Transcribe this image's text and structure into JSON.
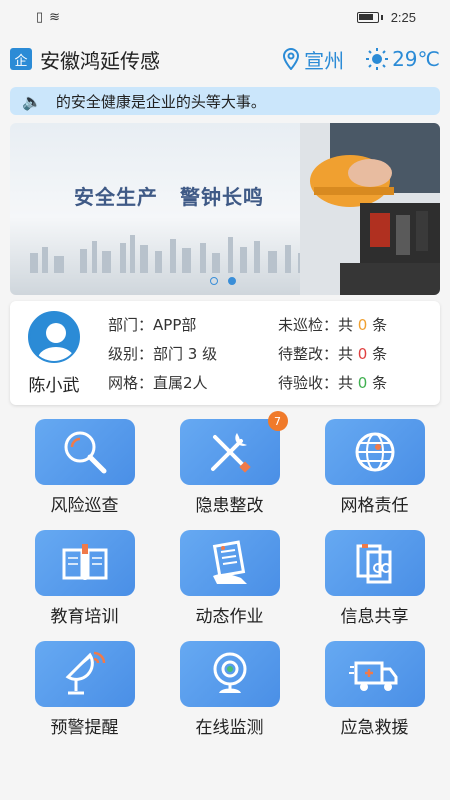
{
  "status_bar": {
    "time": "2:25"
  },
  "header": {
    "logo_char": "企",
    "title": "安徽鸿延传感",
    "location": "宣州",
    "temperature": "29℃"
  },
  "notice": {
    "text": "的安全健康是企业的头等大事。"
  },
  "banner": {
    "slogan_1": "安全生产",
    "slogan_2": "警钟长鸣",
    "page_count": 2,
    "active_page": 2
  },
  "profile": {
    "name": "陈小武",
    "dept_label": "部门：",
    "dept_value": "APP部",
    "level_label": "级别：",
    "level_value": "部门 3 级",
    "grid_label": "网格：",
    "grid_value": "直属2人",
    "uninspected": {
      "label": "未巡检：",
      "pre": "共 ",
      "count": "0",
      "post": " 条"
    },
    "to_rectify": {
      "label": "待整改：",
      "pre": "共 ",
      "count": "0",
      "post": " 条"
    },
    "to_accept": {
      "label": "待验收：",
      "pre": "共 ",
      "count": "0",
      "post": " 条"
    }
  },
  "menu": [
    {
      "label": "风险巡查",
      "icon": "magnifier-icon"
    },
    {
      "label": "隐患整改",
      "icon": "tools-icon",
      "badge": "7"
    },
    {
      "label": "网格责任",
      "icon": "globe-grid-icon"
    },
    {
      "label": "教育培训",
      "icon": "book-icon"
    },
    {
      "label": "动态作业",
      "icon": "hand-document-icon"
    },
    {
      "label": "信息共享",
      "icon": "document-share-icon"
    },
    {
      "label": "预警提醒",
      "icon": "satellite-dish-icon"
    },
    {
      "label": "在线监测",
      "icon": "webcam-icon"
    },
    {
      "label": "应急救援",
      "icon": "ambulance-icon"
    }
  ],
  "colors": {
    "accent": "#2b8bd6",
    "tile": "#4a8fe6",
    "badge": "#f07a2a"
  }
}
